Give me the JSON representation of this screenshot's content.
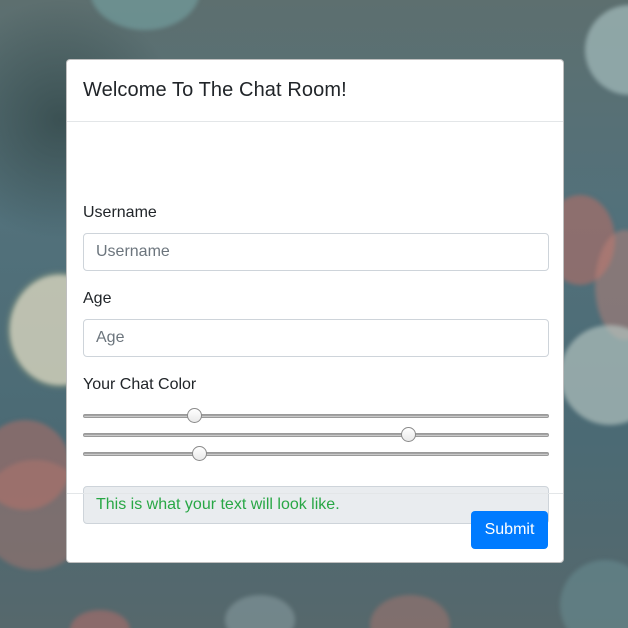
{
  "modal": {
    "title": "Welcome To The Chat Room!"
  },
  "form": {
    "username": {
      "label": "Username",
      "placeholder": "Username",
      "value": ""
    },
    "age": {
      "label": "Age",
      "placeholder": "Age",
      "value": ""
    },
    "chat_color": {
      "label": "Your Chat Color",
      "sliders": [
        {
          "channel_fraction": 0.24
        },
        {
          "channel_fraction": 0.7
        },
        {
          "channel_fraction": 0.25
        }
      ]
    },
    "preview": {
      "text": "This is what your text will look like.",
      "color": "#28a745"
    }
  },
  "footer": {
    "submit_label": "Submit"
  },
  "colors": {
    "primary": "#007bff"
  }
}
